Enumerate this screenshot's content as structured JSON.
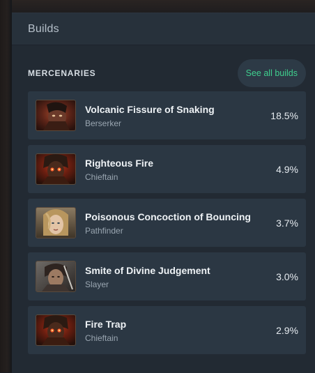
{
  "panel": {
    "title": "Builds"
  },
  "section": {
    "label": "MERCENARIES",
    "see_all_label": "See all builds"
  },
  "builds": [
    {
      "name": "Volcanic Fissure of Snaking",
      "class": "Berserker",
      "percent": "18.5%",
      "portrait": "berserker-portrait"
    },
    {
      "name": "Righteous Fire",
      "class": "Chieftain",
      "percent": "4.9%",
      "portrait": "chieftain-portrait"
    },
    {
      "name": "Poisonous Concoction of Bouncing",
      "class": "Pathfinder",
      "percent": "3.7%",
      "portrait": "pathfinder-portrait"
    },
    {
      "name": "Smite of Divine Judgement",
      "class": "Slayer",
      "percent": "3.0%",
      "portrait": "slayer-portrait"
    },
    {
      "name": "Fire Trap",
      "class": "Chieftain",
      "percent": "2.9%",
      "portrait": "chieftain-portrait"
    }
  ],
  "colors": {
    "accent": "#3fcf8e",
    "panel_bg": "#222a33",
    "row_bg": "#2b3743"
  }
}
